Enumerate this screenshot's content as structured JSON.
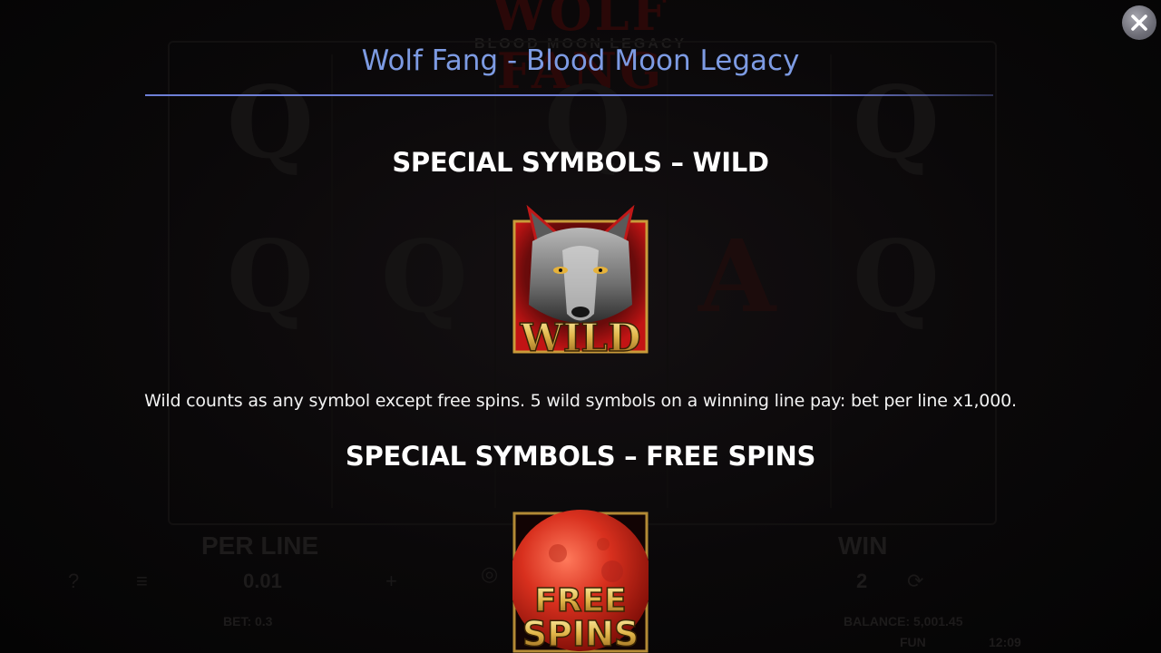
{
  "window": {
    "title": "Wolf Fang - Blood Moon Legacy",
    "close_icon": "close-icon"
  },
  "background_game": {
    "logo": "WOLF FANG",
    "logo_sub": "BLOOD MOON LEGACY",
    "reel_symbols": [
      "Q",
      "Q",
      "Q",
      "Q",
      "Q",
      "A",
      "Q"
    ],
    "per_line_label": "PER LINE",
    "per_line_value": "0.01",
    "win_label": "WIN",
    "win_value": "2",
    "bet_text": "BET: 0.3",
    "balance_text": "BALANCE: 5,001.45",
    "mode_text": "FUN",
    "clock": "12:09"
  },
  "sections": [
    {
      "heading": "SPECIAL SYMBOLS – WILD",
      "symbol_label": "WILD",
      "symbol_icon": "wolf-wild-icon",
      "description": "Wild counts as any symbol except free spins. 5 wild symbols on a winning line pay: bet per line x1,000."
    },
    {
      "heading": "SPECIAL SYMBOLS – FREE SPINS",
      "symbol_label_line1": "FREE",
      "symbol_label_line2": "SPINS",
      "symbol_icon": "blood-moon-free-spins-icon"
    }
  ],
  "colors": {
    "title": "#7d9be3",
    "divider": "#6e7fd6",
    "heading": "#ffffff",
    "gold": "#d9b24a",
    "moon_red": "#c0291c"
  }
}
